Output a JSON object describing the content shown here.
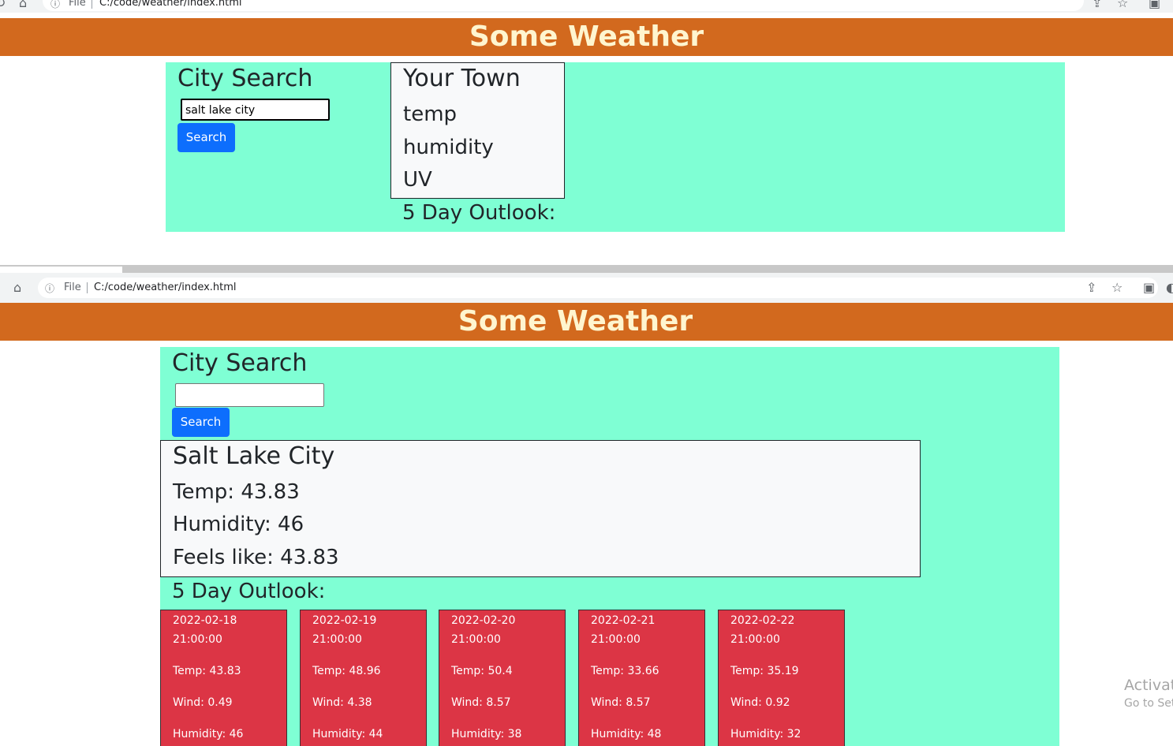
{
  "browser": {
    "file_label": "File",
    "url": "C:/code/weather/index.html"
  },
  "header": {
    "title": "Some Weather"
  },
  "before": {
    "search_heading": "City Search",
    "search_value": "salt lake city",
    "search_button": "Search",
    "current": {
      "city": "Your Town",
      "temp": "temp",
      "humidity": "humidity",
      "uv": "UV"
    },
    "outlook_heading": "5 Day Outlook:"
  },
  "after": {
    "search_heading": "City Search",
    "search_value": "",
    "search_button": "Search",
    "current": {
      "city": "Salt Lake City",
      "temp": "Temp: 43.83",
      "humidity": "Humidity: 46",
      "feels_like": "Feels like: 43.83"
    },
    "outlook_heading": "5 Day Outlook:",
    "forecast": [
      {
        "date": "2022-02-18",
        "time": "21:00:00",
        "temp": "Temp: 43.83",
        "wind": "Wind: 0.49",
        "humidity": "Humidity: 46"
      },
      {
        "date": "2022-02-19",
        "time": "21:00:00",
        "temp": "Temp: 48.96",
        "wind": "Wind: 4.38",
        "humidity": "Humidity: 44"
      },
      {
        "date": "2022-02-20",
        "time": "21:00:00",
        "temp": "Temp: 50.4",
        "wind": "Wind: 8.57",
        "humidity": "Humidity: 38"
      },
      {
        "date": "2022-02-21",
        "time": "21:00:00",
        "temp": "Temp: 33.66",
        "wind": "Wind: 8.57",
        "humidity": "Humidity: 48"
      },
      {
        "date": "2022-02-22",
        "time": "21:00:00",
        "temp": "Temp: 35.19",
        "wind": "Wind: 0.92",
        "humidity": "Humidity: 32"
      }
    ]
  },
  "watermark": {
    "line1": "Activat",
    "line2": "Go to Set"
  },
  "colors": {
    "header_bg": "#d2691e",
    "header_text": "#fff5cf",
    "panel_bg": "#7fffd4",
    "card_bg": "#f8f9fa",
    "forecast_bg": "#dc3545",
    "button_bg": "#0d6efd"
  },
  "icons": [
    "reload-icon",
    "home-icon",
    "info-icon",
    "share-icon",
    "star-icon",
    "profile-icon",
    "extension-icon"
  ]
}
